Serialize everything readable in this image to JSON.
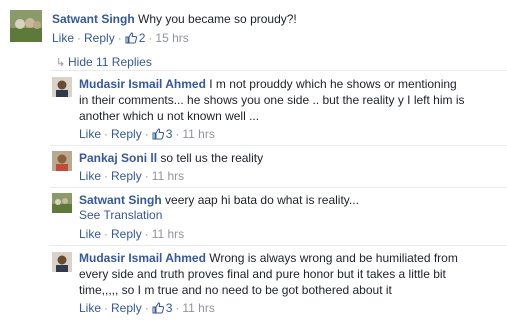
{
  "comments": [
    {
      "author": "Satwant Singh",
      "lines": [
        "Why you became so proudy?!"
      ],
      "like": "Like",
      "reply": "Reply",
      "likes": "2",
      "time": "15 hrs"
    }
  ],
  "hide_replies": "Hide 11 Replies",
  "replies": [
    {
      "author": "Mudasir Ismail Ahmed",
      "lines": [
        "I m not prouddy which he shows or mentioning",
        "in their comments... he shows you one side .. but the reality y I left him is",
        "another which u not known well ..."
      ],
      "like": "Like",
      "reply": "Reply",
      "likes": "3",
      "time": "11 hrs"
    },
    {
      "author": "Pankaj Soni ll",
      "lines": [
        "so tell us the reality"
      ],
      "like": "Like",
      "reply": "Reply",
      "time": "11 hrs"
    },
    {
      "author": "Satwant Singh",
      "lines": [
        "veery aap hi bata do what is reality..."
      ],
      "see_translation": "See Translation",
      "like": "Like",
      "reply": "Reply",
      "time": "11 hrs"
    },
    {
      "author": "Mudasir Ismail Ahmed",
      "lines": [
        "Wrong is always wrong and be humiliated from",
        "every side and truth proves final and pure honor but it takes a little bit",
        "time,,,,, so I m true and no need to be got bothered about it"
      ],
      "like": "Like",
      "reply": "Reply",
      "likes": "3",
      "time": "11 hrs"
    }
  ],
  "colors": {
    "author_blue": "#365899",
    "meta_gray": "#90949c",
    "text": "#1d2129",
    "divider": "#e9ebee"
  }
}
